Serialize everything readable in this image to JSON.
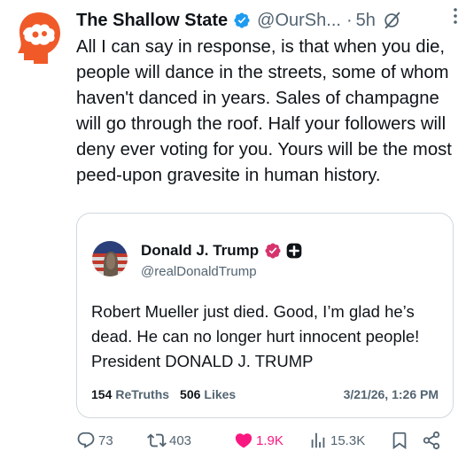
{
  "post": {
    "display_name": "The Shallow State",
    "handle": "@OurSh...",
    "separator": "·",
    "time": "5h",
    "text": "All I can say in response, is that when you die, people will dance in the streets, some of whom haven't danced in years. Sales of champagne will go through the roof. Half your followers will deny ever voting for you. Yours will be the most peed-upon gravesite in human history.",
    "icons": {
      "verified": "verified-badge-icon",
      "grok": "grok-icon",
      "more": "more-vertical-icon"
    }
  },
  "quote": {
    "display_name": "Donald J. Trump",
    "handle": "@realDonaldTrump",
    "text": "Robert Mueller just died. Good, I’m glad he’s dead. He can no longer hurt innocent people! President DONALD J. TRUMP",
    "retruths_count": "154",
    "retruths_label": "ReTruths",
    "likes_count": "506",
    "likes_label": "Likes",
    "date": "3/21/26, 1:26 PM",
    "icons": {
      "verified": "verified-badge-icon",
      "plus": "plus-badge-icon"
    }
  },
  "actions": {
    "reply_count": "73",
    "retweet_count": "403",
    "like_count": "1.9K",
    "views_count": "15.3K",
    "icons": [
      "reply-icon",
      "retweet-icon",
      "heart-icon",
      "views-icon",
      "bookmark-icon",
      "share-icon"
    ]
  },
  "colors": {
    "text": "#0f1419",
    "secondary": "#536471",
    "verified": "#1d9bf0",
    "like": "#f91880",
    "avatar_orange": "#f05a28",
    "quote_verified": "#d6336c",
    "border": "#cfd9de"
  }
}
